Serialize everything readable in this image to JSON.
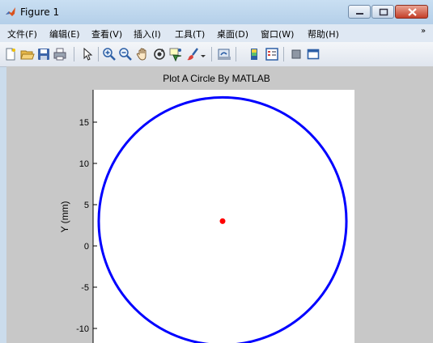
{
  "window": {
    "title": "Figure 1"
  },
  "menu": [
    "文件(F)",
    "编辑(E)",
    "查看(V)",
    "插入(I)",
    "工具(T)",
    "桌面(D)",
    "窗口(W)",
    "帮助(H)"
  ],
  "toolbar": {
    "icons": [
      "new-figure-icon",
      "open-file-icon",
      "save-icon",
      "print-icon",
      "pointer-icon",
      "zoom-in-icon",
      "zoom-out-icon",
      "pan-icon",
      "rotate-3d-icon",
      "data-cursor-icon",
      "brush-icon",
      "link-plot-icon",
      "colorbar-icon",
      "legend-icon",
      "hide-plot-tools-icon",
      "show-plot-tools-icon"
    ]
  },
  "chart_data": {
    "type": "scatter",
    "title": "Plot A Circle By MATLAB",
    "ylabel": "Y (mm)",
    "xlabel": "",
    "yticks": [
      15,
      10,
      5,
      0,
      -5,
      -10
    ],
    "ylim": [
      -12,
      19
    ],
    "series": [
      {
        "kind": "circle",
        "center": [
          0,
          3
        ],
        "radius": 15,
        "color": "#0000ff"
      },
      {
        "kind": "point",
        "x": 0,
        "y": 3,
        "color": "#ff0000"
      }
    ]
  }
}
